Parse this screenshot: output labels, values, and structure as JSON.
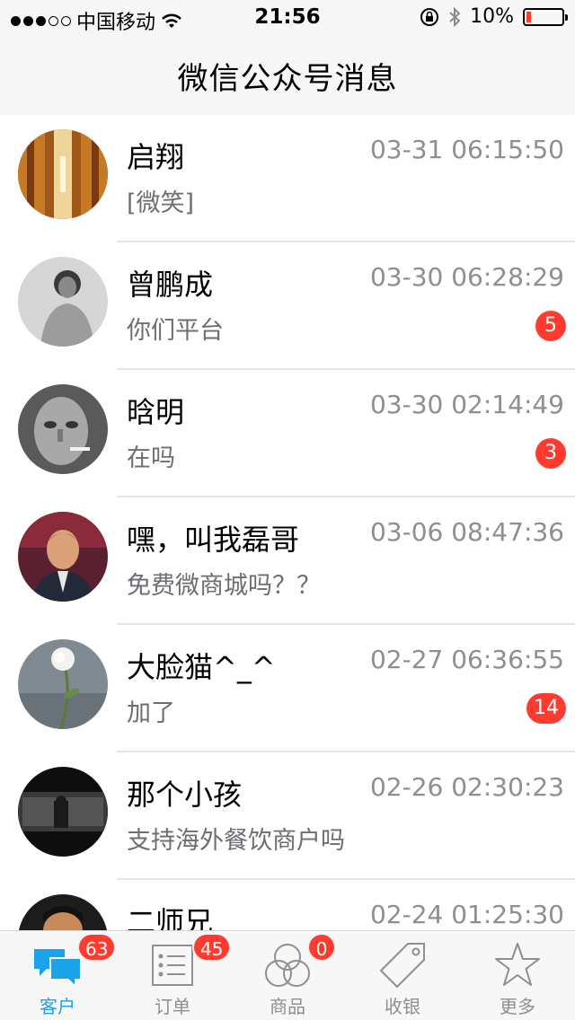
{
  "status_bar": {
    "carrier": "中国移动",
    "time": "21:56",
    "battery": "10%",
    "signal_icon": "signal-dots-icon",
    "wifi_icon": "wifi-icon",
    "lock_icon": "rotation-lock-icon",
    "bluetooth_icon": "bluetooth-icon"
  },
  "header": {
    "title": "微信公众号消息"
  },
  "conversations": [
    {
      "name": "启翔",
      "time": "03-31 06:15:50",
      "message": "[微笑]",
      "badge": ""
    },
    {
      "name": "曾鹏成",
      "time": "03-30 06:28:29",
      "message": "你们平台",
      "badge": "5"
    },
    {
      "name": "晗明",
      "time": "03-30 02:14:49",
      "message": "在吗",
      "badge": "3"
    },
    {
      "name": "嘿，叫我磊哥",
      "time": "03-06 08:47:36",
      "message": "免费微商城吗？？",
      "badge": ""
    },
    {
      "name": "大脸猫^_^",
      "time": "02-27 06:36:55",
      "message": "加了",
      "badge": "14"
    },
    {
      "name": "那个小孩",
      "time": "02-26 02:30:23",
      "message": "支持海外餐饮商户吗",
      "badge": ""
    },
    {
      "name": "二师兄",
      "time": "02-24 01:25:30",
      "message": "",
      "badge": ""
    }
  ],
  "tabs": [
    {
      "label": "客户",
      "badge": "63",
      "icon": "chat-bubbles-icon",
      "active": true
    },
    {
      "label": "订单",
      "badge": "45",
      "icon": "order-list-icon",
      "active": false
    },
    {
      "label": "商品",
      "badge": "0",
      "icon": "product-circles-icon",
      "active": false
    },
    {
      "label": "收银",
      "badge": "",
      "icon": "price-tag-icon",
      "active": false
    },
    {
      "label": "更多",
      "badge": "",
      "icon": "star-icon",
      "active": false
    }
  ],
  "colors": {
    "accent": "#1aa3e8",
    "badge": "#ff3b30",
    "battery_low": "#ff3b30"
  }
}
